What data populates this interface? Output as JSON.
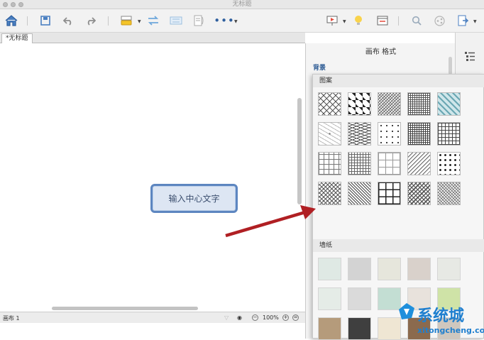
{
  "window": {
    "title": "无标题"
  },
  "tabs": [
    {
      "label": "*无标题"
    }
  ],
  "canvas": {
    "central_topic": "输入中心文字"
  },
  "status": {
    "sheet": "画布 1",
    "zoom": "100%"
  },
  "panel": {
    "title": "画布 格式",
    "section": "背景",
    "popup": {
      "patterns_label": "图案",
      "wallpapers_label": "墙纸"
    }
  },
  "watermark": {
    "brand": "系统城",
    "url": "xitongcheng.com"
  },
  "colors": {
    "topic_border": "#5d86c0",
    "arrow": "#b01f23",
    "accent_blue": "#2d5b94"
  },
  "icons": [
    "home-icon",
    "save-icon",
    "undo-icon",
    "redo-icon",
    "style-icon",
    "relationship-icon",
    "boundary-icon",
    "summary-icon",
    "more-icon",
    "presentation-icon",
    "idea-icon",
    "outline-icon",
    "search-icon",
    "share-icon",
    "export-icon",
    "format-panel-icon"
  ]
}
